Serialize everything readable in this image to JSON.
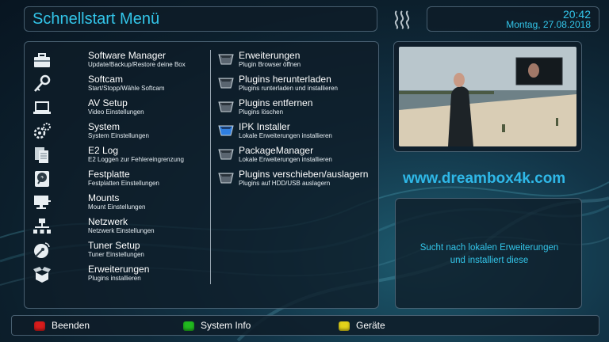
{
  "header": {
    "title": "Schnellstart Menü",
    "time": "20:42",
    "date": "Montag, 27.08.2018"
  },
  "menu": {
    "left": [
      {
        "label": "Software Manager",
        "sub": "Update/Backup/Restore deine Box",
        "icon": "toolbox-icon"
      },
      {
        "label": "Softcam",
        "sub": "Start/Stopp/Wähle Softcam",
        "icon": "key-icon"
      },
      {
        "label": "AV Setup",
        "sub": "Video Einstellungen",
        "icon": "laptop-icon"
      },
      {
        "label": "System",
        "sub": "System Einstellungen",
        "icon": "gears-icon"
      },
      {
        "label": "E2 Log",
        "sub": "E2 Loggen zur Fehlereingrenzung",
        "icon": "documents-icon"
      },
      {
        "label": "Festplatte",
        "sub": "Festplatten Einstellungen",
        "icon": "harddisk-icon"
      },
      {
        "label": "Mounts",
        "sub": "Mount Einstellungen",
        "icon": "network-monitor-icon"
      },
      {
        "label": "Netzwerk",
        "sub": "Netzwerk Einstellungen",
        "icon": "network-icon"
      },
      {
        "label": "Tuner Setup",
        "sub": "Tuner Einstellungen",
        "icon": "satellite-dish-icon"
      },
      {
        "label": "Erweiterungen",
        "sub": "Plugins installieren",
        "icon": "box-open-icon"
      }
    ],
    "right": [
      {
        "label": "Erweiterungen",
        "sub": "Plugin Browser öffnen",
        "selected": false
      },
      {
        "label": "Plugins herunterladen",
        "sub": "Plugins runterladen und installieren",
        "selected": false
      },
      {
        "label": "Plugins entfernen",
        "sub": "Plugins löschen",
        "selected": false
      },
      {
        "label": "IPK Installer",
        "sub": "Lokale Erweiterungen installieren",
        "selected": true
      },
      {
        "label": "PackageManager",
        "sub": "Lokale Erweiterungen installieren",
        "selected": false
      },
      {
        "label": "Plugins verschieben/auslagern",
        "sub": "Plugins auf HDD/USB auslagern",
        "selected": false
      }
    ]
  },
  "watermark": "www.dreambox4k.com",
  "description": {
    "line1": "Sucht nach lokalen Erweiterungen",
    "line2": "und installiert diese"
  },
  "footer": {
    "red": "Beenden",
    "green": "System Info",
    "yellow": "Geräte"
  },
  "colors": {
    "accent": "#33c6ea",
    "red_key": "#d81c1c",
    "green_key": "#21b81f",
    "yellow_key": "#e2d21a",
    "selected_bullet": "#2f7fe0"
  }
}
